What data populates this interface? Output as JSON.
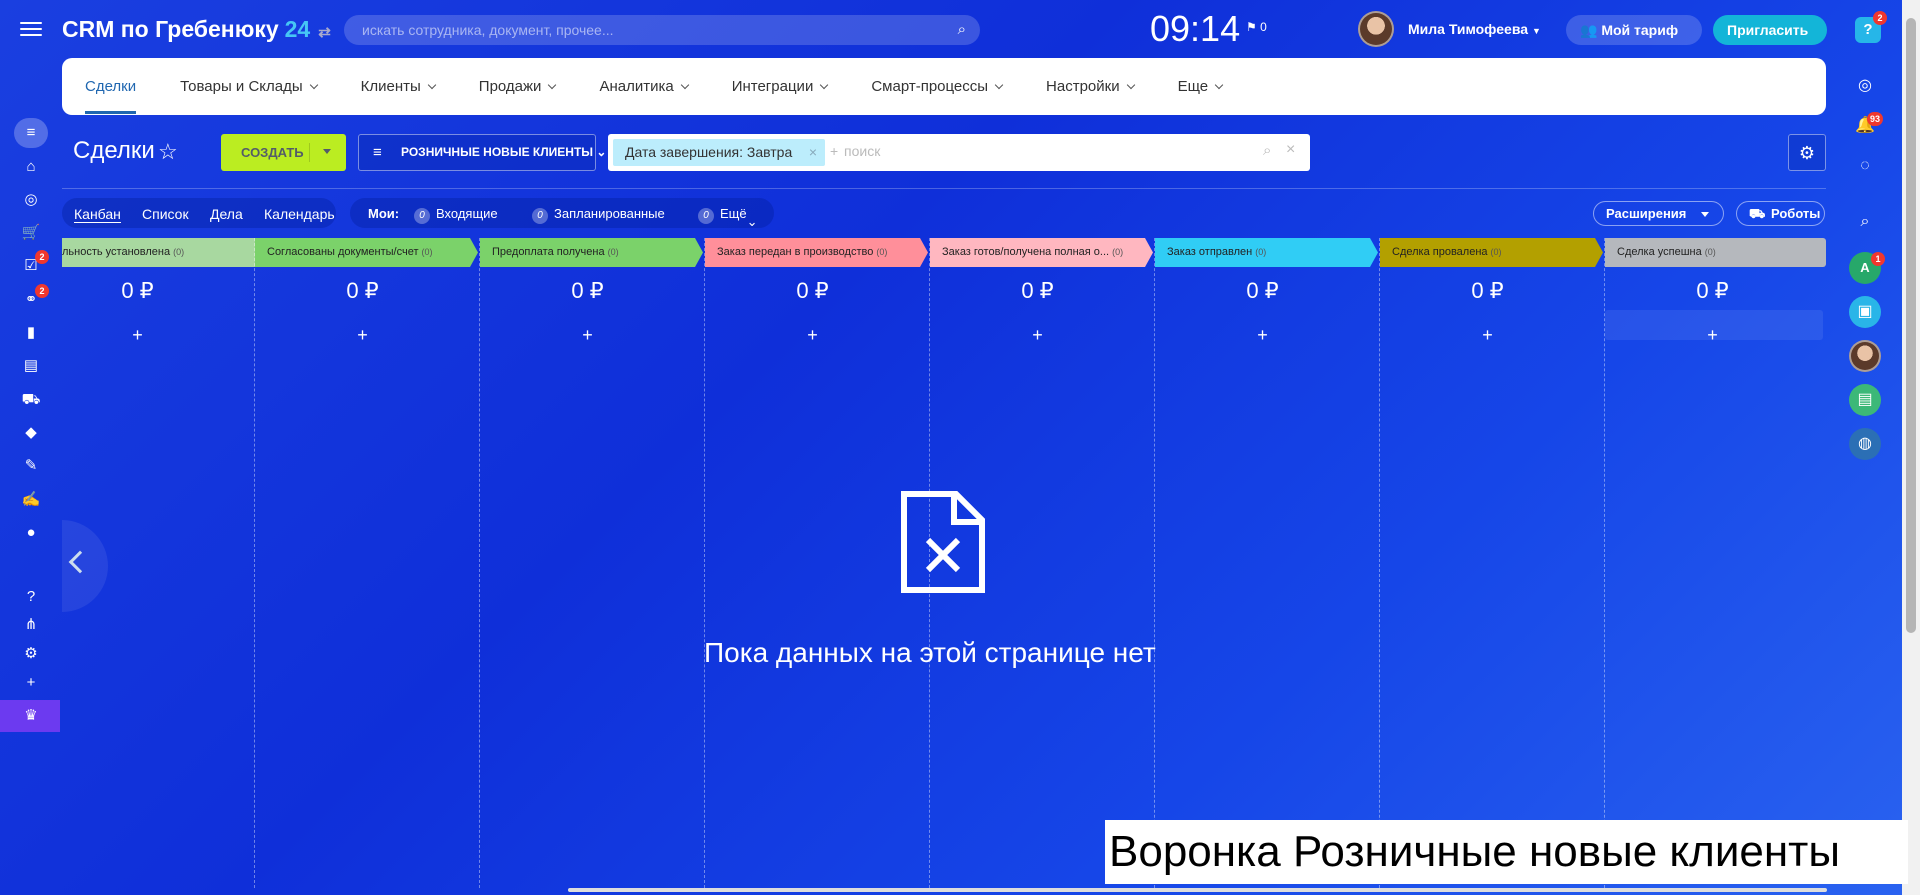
{
  "app": {
    "title": "CRM по Гребенюку",
    "title_num": "24",
    "switch_icon": "⇄"
  },
  "search": {
    "placeholder": "искать сотрудника, документ, прочее..."
  },
  "clock": "09:14",
  "flag_count": "0",
  "user": {
    "name": "Мила Тимофеева"
  },
  "tariff_label": "Мой тариф",
  "invite_label": "Пригласить",
  "help_badge": "2",
  "menu": [
    {
      "label": "Сделки",
      "active": true
    },
    {
      "label": "Товары и Склады"
    },
    {
      "label": "Клиенты"
    },
    {
      "label": "Продажи"
    },
    {
      "label": "Аналитика"
    },
    {
      "label": "Интеграции"
    },
    {
      "label": "Смарт-процессы"
    },
    {
      "label": "Настройки"
    },
    {
      "label": "Еще"
    }
  ],
  "page_title": "Сделки",
  "create_label": "СОЗДАТЬ",
  "funnel_label": "РОЗНИЧНЫЕ НОВЫЕ КЛИЕНТЫ",
  "filter": {
    "chip": "Дата завершения: Завтра",
    "plus": "+",
    "placeholder": "поиск"
  },
  "views": [
    "Канбан",
    "Список",
    "Дела",
    "Календарь"
  ],
  "mine": {
    "label": "Мои:",
    "items": [
      {
        "count": "0",
        "label": "Входящие"
      },
      {
        "count": "0",
        "label": "Запланированные"
      },
      {
        "count": "0",
        "label": "Ещё"
      }
    ]
  },
  "extensions_label": "Расширения",
  "robots_label": "Роботы",
  "stages": [
    {
      "name": "льность установлена",
      "count": "(0)",
      "color": "#a8d8a0"
    },
    {
      "name": "Согласованы документы/счет",
      "count": "(0)",
      "color": "#7bd26a"
    },
    {
      "name": "Предоплата получена",
      "count": "(0)",
      "color": "#7bd26a"
    },
    {
      "name": "Заказ передан в производство",
      "count": "(0)",
      "color": "#ff8f9a"
    },
    {
      "name": "Заказ готов/получена полная о...",
      "count": "(0)",
      "color": "#ffb7c0"
    },
    {
      "name": "Заказ отправлен",
      "count": "(0)",
      "color": "#30cdf5"
    },
    {
      "name": "Сделка провалена",
      "count": "(0)",
      "color": "#b3a000"
    },
    {
      "name": "Сделка успешна",
      "count": "(0)",
      "color": "#b5b8bd"
    }
  ],
  "column_sum": "0 ₽",
  "column_add": "+",
  "left_badges": [
    "2",
    "2"
  ],
  "right_badges": {
    "notifications": "93",
    "avatar_a": "1"
  },
  "avatar_letter": "A",
  "empty_text": "Пока данных на этой странице нет",
  "caption": "Воронка Розничные новые клиенты",
  "icons": {
    "magnifier": "⌕",
    "close": "×",
    "gear": "⚙",
    "robot": "⛟",
    "funnel": "≡"
  }
}
